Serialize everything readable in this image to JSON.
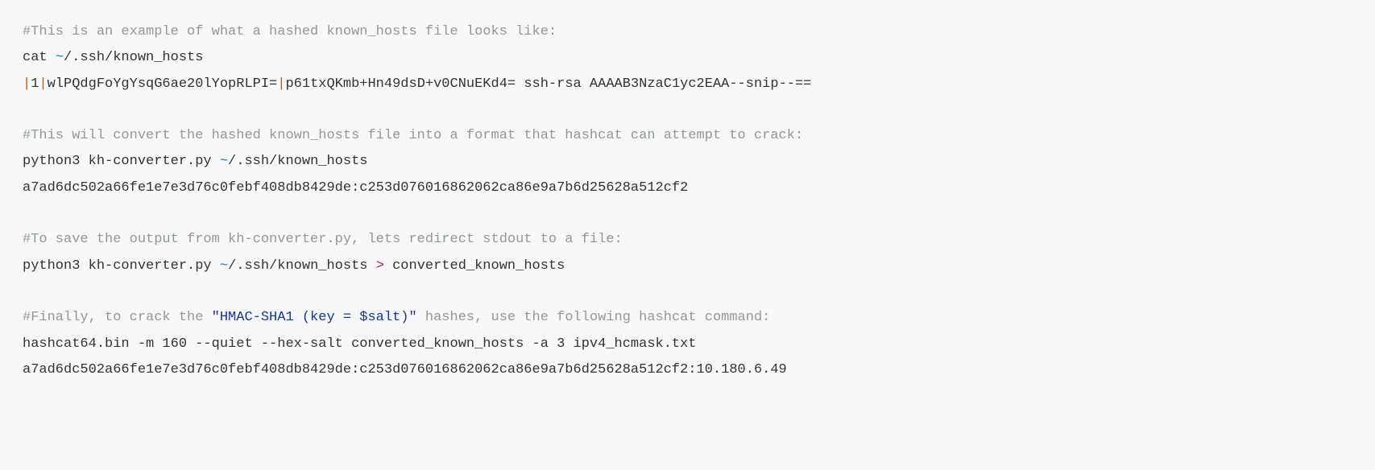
{
  "comment1": "#This is an example of what a hashed known_hosts file looks like:",
  "cmd1_a": "cat ",
  "cmd1_tilde": "~",
  "cmd1_b": "/.ssh/known_hosts",
  "out1_pipe1": "|",
  "out1_seg1": "1",
  "out1_pipe2": "|",
  "out1_seg2": "wlPQdgFoYgYsqG6ae20lYopRLPI=",
  "out1_pipe3": "|",
  "out1_seg3": "p61txQKmb+Hn49dsD+v0CNuEKd4= ssh-rsa AAAAB3NzaC1yc2EAA--snip--==",
  "comment2": "#This will convert the hashed known_hosts file into a format that hashcat can attempt to crack:",
  "cmd2_a": "python3 kh-converter.py ",
  "cmd2_tilde": "~",
  "cmd2_b": "/.ssh/known_hosts",
  "out2": "a7ad6dc502a66fe1e7e3d76c0febf408db8429de:c253d076016862062ca86e9a7b6d25628a512cf2",
  "comment3": "#To save the output from kh-converter.py, lets redirect stdout to a file:",
  "cmd3_a": "python3 kh-converter.py ",
  "cmd3_tilde": "~",
  "cmd3_b": "/.ssh/known_hosts ",
  "cmd3_redir": ">",
  "cmd3_c": " converted_known_hosts",
  "comment4_a": "#Finally, to crack the ",
  "comment4_str": "\"HMAC-SHA1 (key = $salt)\"",
  "comment4_b": " hashes, use the following hashcat command:",
  "cmd4": "hashcat64.bin -m 160 --quiet --hex-salt converted_known_hosts -a 3 ipv4_hcmask.txt",
  "out4": "a7ad6dc502a66fe1e7e3d76c0febf408db8429de:c253d076016862062ca86e9a7b6d25628a512cf2:10.180.6.49"
}
